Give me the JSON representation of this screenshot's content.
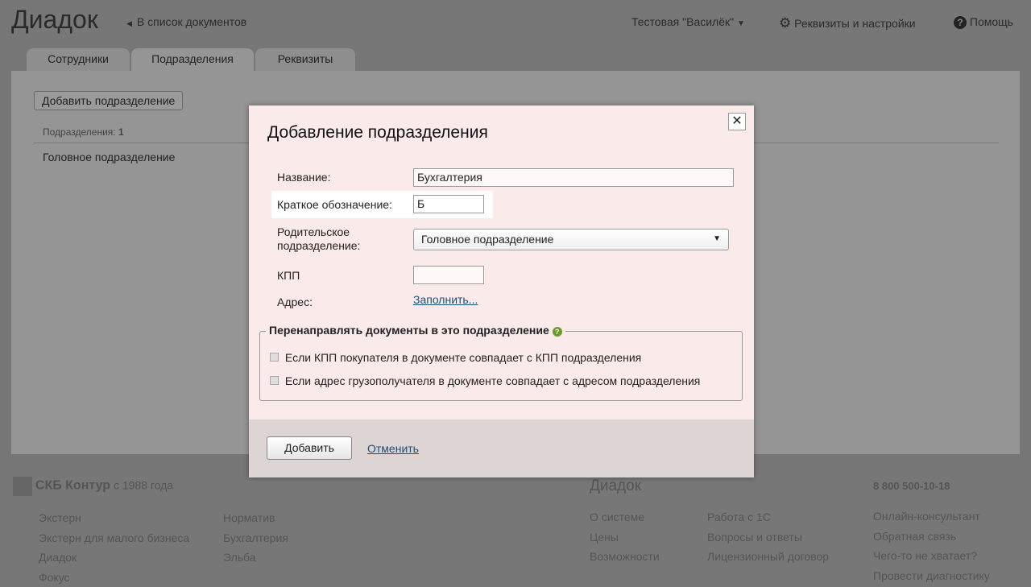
{
  "header": {
    "logo": "Диадок",
    "back": "В список документов",
    "org": "Тестовая \"Василёк\"",
    "settings": "Реквизиты и настройки",
    "help": "Помощь"
  },
  "tabs": [
    "Сотрудники",
    "Подразделения",
    "Реквизиты"
  ],
  "main": {
    "add_button": "Добавить подразделение",
    "count_label": "Подразделения:",
    "count": "1",
    "items": [
      "Головное подразделение"
    ]
  },
  "dialog": {
    "title": "Добавление подразделения",
    "name_label": "Название:",
    "name_value": "Бухгалтерия",
    "short_label": "Краткое обозначение:",
    "short_value": "Б",
    "parent_label": "Родительское подразделение:",
    "parent_value": "Головное подразделение",
    "kpp_label": "КПП",
    "kpp_value": "",
    "address_label": "Адрес:",
    "address_link": "Заполнить...",
    "redirect_title": "Перенаправлять документы в это подразделение",
    "redirect_options": [
      "Если КПП покупателя в документе совпадает с КПП подразделения",
      "Если адрес грузополучателя в документе совпадает с адресом подразделения"
    ],
    "submit": "Добавить",
    "cancel": "Отменить"
  },
  "footer": {
    "brand": "СКБ Контур",
    "since": "с 1988 года",
    "col1": [
      "Экстерн",
      "Экстерн для малого бизнеса",
      "Диадок",
      "Фокус"
    ],
    "col2": [
      "Норматив",
      "Бухгалтерия",
      "Эльба"
    ],
    "diadoc_title": "Диадок",
    "col3": [
      "О системе",
      "Цены",
      "Возможности"
    ],
    "col4": [
      "Работа с 1С",
      "Вопросы и ответы",
      "Лицензионный договор"
    ],
    "phone": "8 800 500-10-18",
    "col5": [
      "Онлайн-консультант",
      "Обратная связь",
      "Чего-то не хватает?",
      "Провести диагностику"
    ]
  }
}
